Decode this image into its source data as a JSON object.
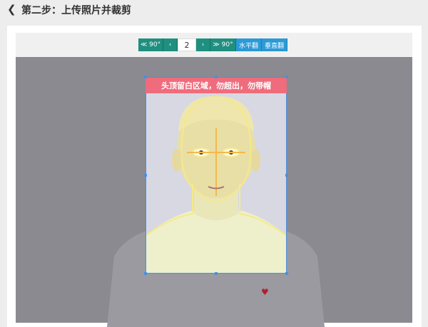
{
  "header": {
    "back_icon": "chevron-left-icon",
    "title": "第二步：上传照片并裁剪"
  },
  "toolbar": {
    "rotate_left_label": "≪ 90°",
    "prev_label": "‹",
    "page_number": "2",
    "next_label": "›",
    "rotate_right_label": "≫ 90°",
    "flip_horizontal_label": "水平翻",
    "flip_vertical_label": "垂直翻"
  },
  "crop": {
    "banner_text": "头顶留白区域，勿超出，勿带帽"
  },
  "colors": {
    "primary_teal": "#1f8f7f",
    "accent_blue": "#2b9ad6",
    "banner_pink": "#ef6c7d",
    "guide_yellow": "#f5e98a"
  }
}
